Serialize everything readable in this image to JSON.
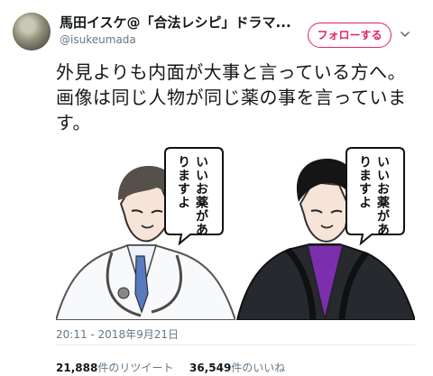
{
  "author": {
    "name": "馬田イスケ@「合法レシピ」ドラマ...",
    "handle": "@isukeumada"
  },
  "actions": {
    "follow_label": "フォローする",
    "menu_icon": "chevron-down-icon"
  },
  "tweet": {
    "text": "外見よりも内面が大事と言っている方へ。画像は同じ人物が同じ薬の事を言っています。"
  },
  "image": {
    "left_bubble": "いいお薬がありますよ",
    "right_bubble": "いいお薬がありますよ"
  },
  "meta": {
    "timestamp": "20:11 - 2018年9月21日",
    "retweet_count": "21,888",
    "retweet_label": "件のリツイート",
    "like_count": "36,549",
    "like_label": "件のいいね"
  },
  "colors": {
    "accent": "#e0245e",
    "secondary_text": "#657786",
    "text": "#14171a"
  }
}
